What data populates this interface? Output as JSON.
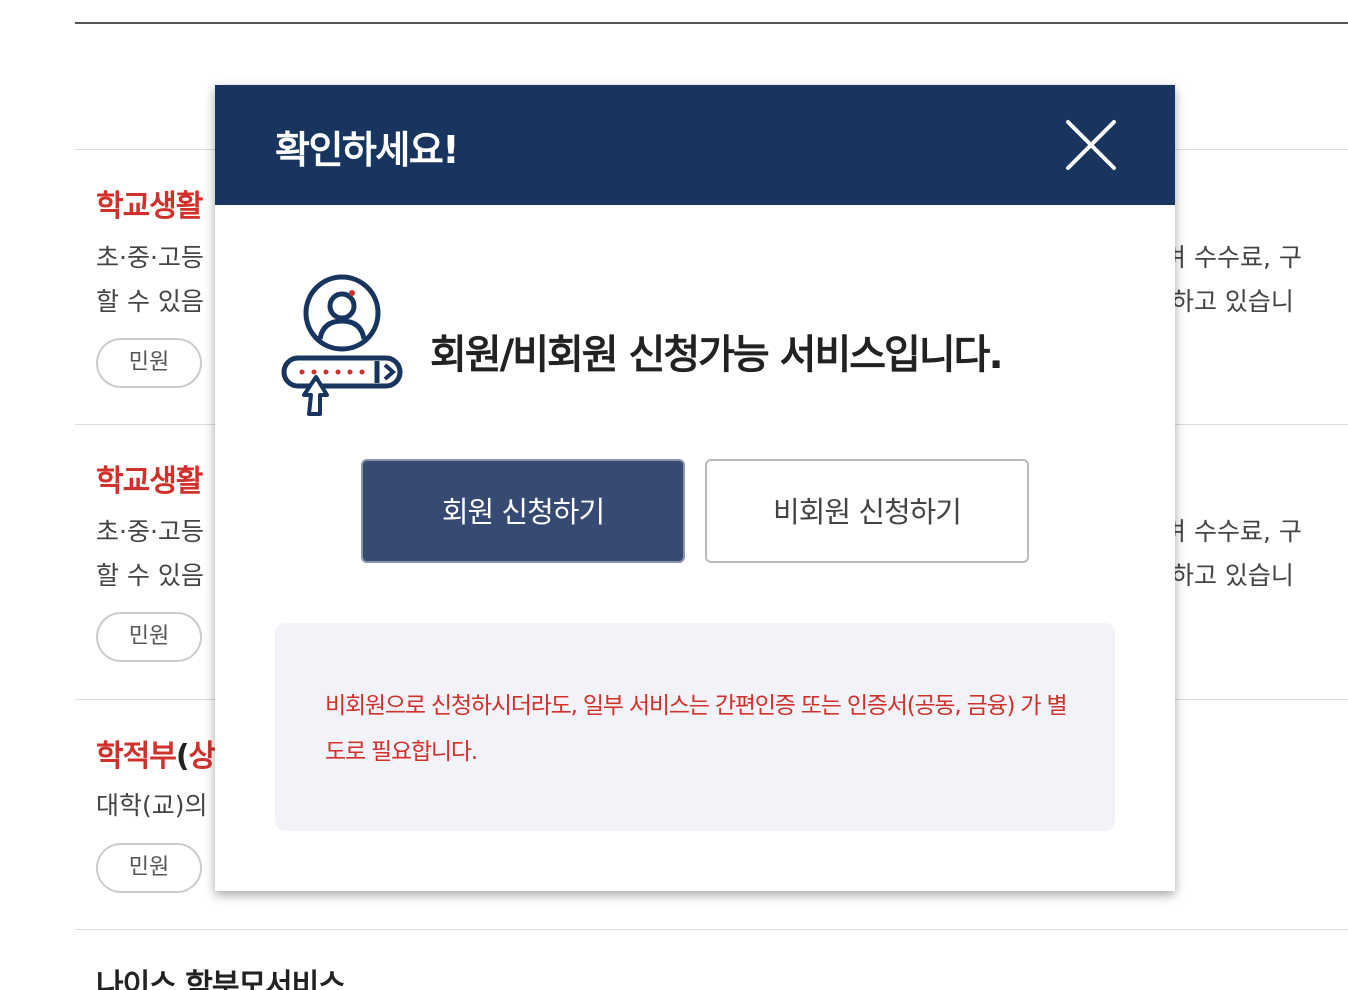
{
  "background_results": [
    {
      "title": "학교생활",
      "desc_line1": "초·중·고등",
      "desc_line2": "할 수 있음",
      "desc_right1": "르며 수수료, 구",
      "desc_right2": "서 하고 있습니",
      "tag": "민원"
    },
    {
      "title": "학교생활",
      "desc_line1": "초·중·고등",
      "desc_line2": "할 수 있음",
      "desc_right1": "르며 수수료, 구",
      "desc_right2": "서 하고 있습니",
      "tag": "민원"
    },
    {
      "title_red1": "학적부",
      "title_paren": "(",
      "title_red2": "상",
      "desc_line1": "대학(교)의",
      "tag": "민원"
    },
    {
      "title": "나이스 학부모서비스"
    }
  ],
  "modal": {
    "title": "확인하세요!",
    "message": "회원/비회원 신청가능 서비스입니다.",
    "member_button": "회원 신청하기",
    "guest_button": "비회원 신청하기",
    "notice": "비회원으로 신청하시더라도, 일부 서비스는 간편인증 또는 인증서(공동, 금융) 가 별도로 필요합니다.",
    "icons": {
      "close": "close-icon",
      "member_login": "user-login-icon"
    }
  },
  "colors": {
    "header_bg": "#17355e",
    "member_button_bg": "#374a73",
    "accent_red": "#d1302b",
    "notice_bg": "#f1f3f8"
  }
}
